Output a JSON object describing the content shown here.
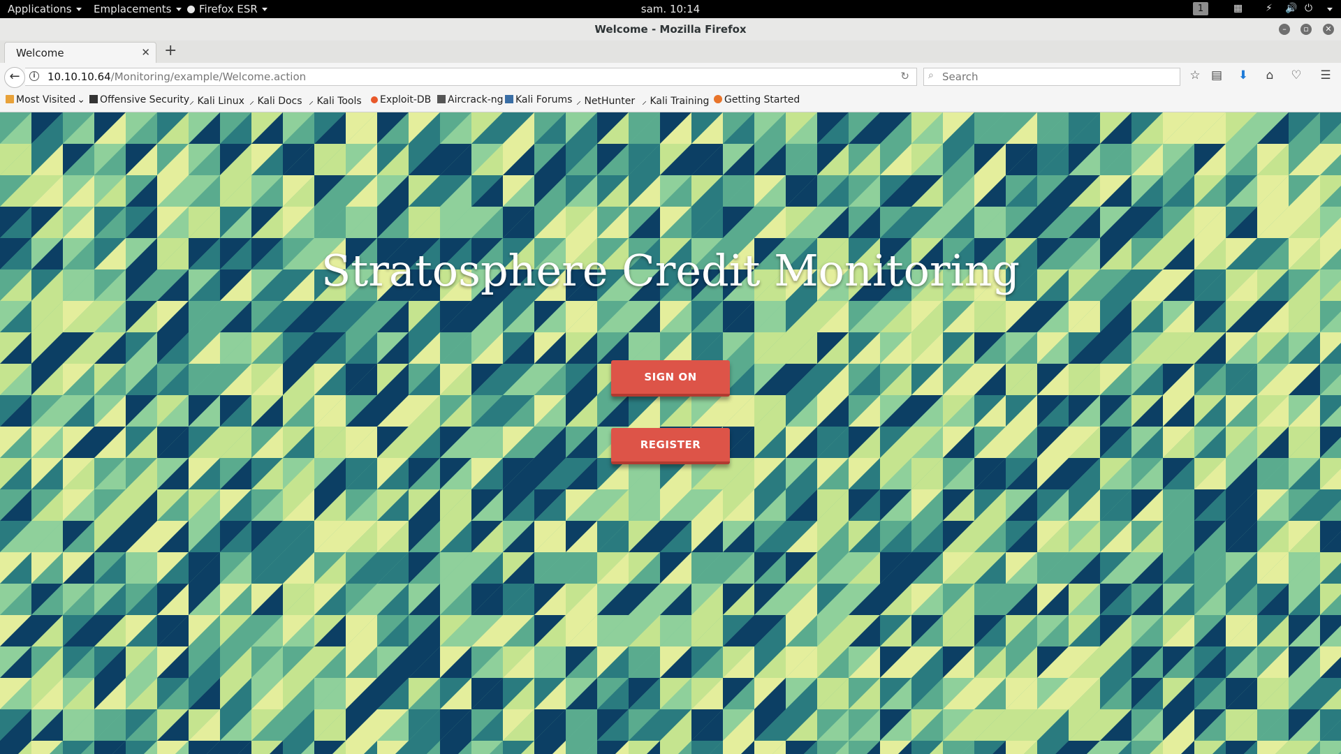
{
  "topbar": {
    "applications": "Applications",
    "places": "Emplacements",
    "app_menu": "Firefox ESR",
    "clock": "sam. 10:14",
    "workspace": "1"
  },
  "window": {
    "title": "Welcome - Mozilla Firefox"
  },
  "tabs": [
    {
      "label": "Welcome"
    }
  ],
  "navbar": {
    "url_host": "10.10.10.64",
    "url_path": "/Monitoring/example/Welcome.action",
    "search_placeholder": "Search"
  },
  "bookmarks": [
    {
      "label": "Most Visited",
      "icon": "folder-icon"
    },
    {
      "label": "Offensive Security",
      "icon": "offsec-icon"
    },
    {
      "label": "Kali Linux",
      "icon": "kali-dragon-icon"
    },
    {
      "label": "Kali Docs",
      "icon": "kali-dragon-icon"
    },
    {
      "label": "Kali Tools",
      "icon": "kali-dragon-icon"
    },
    {
      "label": "Exploit-DB",
      "icon": "exploitdb-icon"
    },
    {
      "label": "Aircrack-ng",
      "icon": "aircrack-icon"
    },
    {
      "label": "Kali Forums",
      "icon": "forums-icon"
    },
    {
      "label": "NetHunter",
      "icon": "kali-dragon-icon"
    },
    {
      "label": "Kali Training",
      "icon": "kali-dragon-icon"
    },
    {
      "label": "Getting Started",
      "icon": "firefox-icon"
    }
  ],
  "page": {
    "heading": "Stratosphere Credit Monitoring",
    "sign_on_label": "SIGN ON",
    "register_label": "REGISTER"
  },
  "colors": {
    "button": "#dd5448",
    "pattern": [
      "#0c3f64",
      "#2a7b7f",
      "#5aab8e",
      "#8fd09b",
      "#c5e48f",
      "#e4ee9c"
    ]
  }
}
